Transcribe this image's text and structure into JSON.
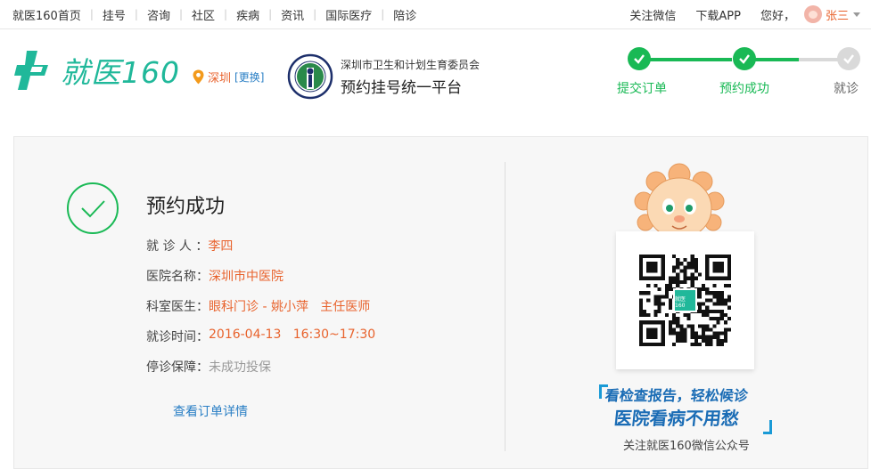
{
  "topnav": {
    "items": [
      "就医160首页",
      "挂号",
      "咨询",
      "社区",
      "疾病",
      "资讯",
      "国际医疗",
      "陪诊"
    ],
    "follow_wechat": "关注微信",
    "download_app": "下载APP",
    "greeting": "您好，",
    "username": "张三"
  },
  "header": {
    "logo_text": "就医160",
    "city": "深圳",
    "change_city": "[更换]",
    "org_line1": "深圳市卫生和计划生育委员会",
    "org_line2": "预约挂号统一平台"
  },
  "steps": [
    {
      "label": "提交订单",
      "done": true
    },
    {
      "label": "预约成功",
      "done": true
    },
    {
      "label": "就诊",
      "done": false
    }
  ],
  "result": {
    "title": "预约成功",
    "rows": [
      {
        "label": "就 诊 人 ：",
        "value": "李四",
        "muted": false
      },
      {
        "label": "医院名称：",
        "value": "深圳市中医院",
        "muted": false
      },
      {
        "label": "科室医生：",
        "value": "眼科门诊 - 姚小萍   主任医师",
        "muted": false
      },
      {
        "label": "就诊时间：",
        "value": "2016-04-13   16:30~17:30",
        "muted": false
      },
      {
        "label": "停诊保障：",
        "value": "未成功投保",
        "muted": true
      }
    ],
    "detail_link": "查看订单详情"
  },
  "promo": {
    "qr_logo_text": "就医160",
    "slogan1": "看检查报告，轻松候诊",
    "slogan2": "医院看病不用愁",
    "follow": "关注就医160微信公众号"
  },
  "colors": {
    "brand_green": "#20b89a",
    "step_green": "#19b955",
    "accent_orange": "#e8622c",
    "link_blue": "#2a7fc5",
    "slogan_blue": "#1a6cb5"
  }
}
